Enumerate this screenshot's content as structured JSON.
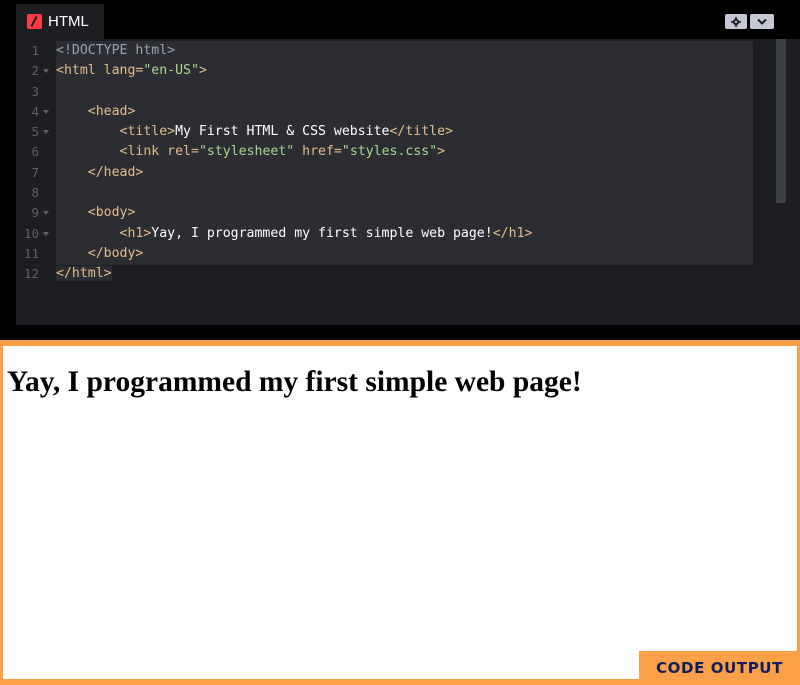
{
  "editor": {
    "tab_label": "HTML",
    "tab_icon": "codepen-html-icon",
    "controls": [
      "gear-icon",
      "chevron-down-icon"
    ],
    "colors": {
      "background": "#1d1e22",
      "tag": "#e3bd89",
      "string": "#a9d78c",
      "text": "#ffffff"
    },
    "gutter": [
      {
        "num": "1",
        "fold": false
      },
      {
        "num": "2",
        "fold": true
      },
      {
        "num": "3",
        "fold": false
      },
      {
        "num": "4",
        "fold": true
      },
      {
        "num": "5",
        "fold": true
      },
      {
        "num": "6",
        "fold": false
      },
      {
        "num": "7",
        "fold": false
      },
      {
        "num": "8",
        "fold": false
      },
      {
        "num": "9",
        "fold": true
      },
      {
        "num": "10",
        "fold": true
      },
      {
        "num": "11",
        "fold": false
      },
      {
        "num": "12",
        "fold": false
      }
    ],
    "lines": [
      [
        {
          "t": "<!DOCTYPE html>",
          "c": "doctype"
        }
      ],
      [
        {
          "t": "<html ",
          "c": "tag"
        },
        {
          "t": "lang",
          "c": "attr"
        },
        {
          "t": "=",
          "c": "tag"
        },
        {
          "t": "\"en-US\"",
          "c": "str"
        },
        {
          "t": ">",
          "c": "tag"
        }
      ],
      [],
      [
        {
          "t": "    <head>",
          "c": "tag"
        }
      ],
      [
        {
          "t": "        <title>",
          "c": "tag"
        },
        {
          "t": "My First HTML & CSS website",
          "c": "txt"
        },
        {
          "t": "</title>",
          "c": "tag"
        }
      ],
      [
        {
          "t": "        <link ",
          "c": "tag"
        },
        {
          "t": "rel",
          "c": "attr"
        },
        {
          "t": "=",
          "c": "tag"
        },
        {
          "t": "\"stylesheet\"",
          "c": "str"
        },
        {
          "t": " ",
          "c": "tag"
        },
        {
          "t": "href",
          "c": "attr"
        },
        {
          "t": "=",
          "c": "tag"
        },
        {
          "t": "\"styles.css\"",
          "c": "str"
        },
        {
          "t": ">",
          "c": "tag"
        }
      ],
      [
        {
          "t": "    </head>",
          "c": "tag"
        }
      ],
      [],
      [
        {
          "t": "    <body>",
          "c": "tag"
        }
      ],
      [
        {
          "t": "        <h1>",
          "c": "tag"
        },
        {
          "t": "Yay, I programmed my first simple web page!",
          "c": "txt"
        },
        {
          "t": "</h1>",
          "c": "tag"
        }
      ],
      [
        {
          "t": "    </body>",
          "c": "tag"
        }
      ],
      [
        {
          "t": "</html>",
          "c": "tag"
        }
      ]
    ]
  },
  "output": {
    "heading": "Yay, I programmed my first simple web page!",
    "badge": "CODE OUTPUT",
    "frame_color": "#f9a049"
  }
}
